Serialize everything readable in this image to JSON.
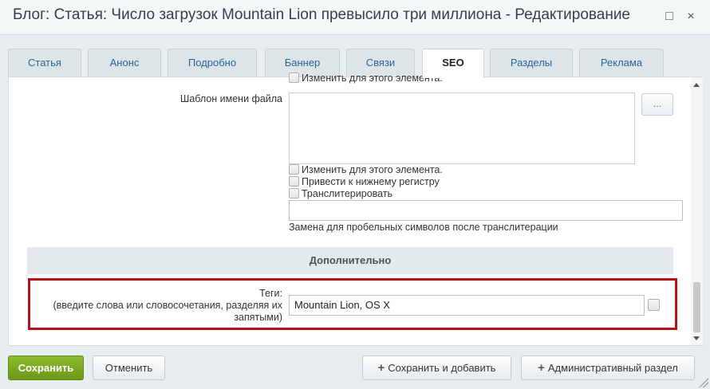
{
  "window": {
    "title": "Блог: Статья: Число загрузок Mountain Lion превысило три миллиона - Редактирование",
    "maximize_icon": "maximize-icon",
    "close_icon": "close-icon",
    "maximize_glyph": "□",
    "close_glyph": "×"
  },
  "tabs": [
    {
      "label": "Статья"
    },
    {
      "label": "Анонс"
    },
    {
      "label": "Подробно"
    },
    {
      "label": "Баннер"
    },
    {
      "label": "Связи"
    },
    {
      "label": "SEO",
      "active": true
    },
    {
      "label": "Разделы"
    },
    {
      "label": "Реклама"
    }
  ],
  "form": {
    "partial_checkbox_label": "Изменить для этого элемента.",
    "file_name_template_label": "Шаблон имени файла",
    "file_name_template_value": "",
    "dots_button": "...",
    "checkboxes": [
      {
        "label": "Изменить для этого элемента.",
        "checked": false
      },
      {
        "label": "Привести к нижнему регистру",
        "checked": false
      },
      {
        "label": "Транслитерировать",
        "checked": false
      }
    ],
    "space_replacement_value": "",
    "space_replacement_hint": "Замена для пробельных символов после транслитерации",
    "section_title": "Дополнительно",
    "tags_label_line1": "Теги:",
    "tags_label_line2": "(введите слова или словосочетания, разделяя их",
    "tags_label_line3": "запятыми)",
    "tags_value": "Mountain Lion, OS X"
  },
  "buttons": {
    "save": "Сохранить",
    "cancel": "Отменить",
    "save_and_add": "Сохранить и добавить",
    "admin_section": "Административный раздел",
    "plus_glyph": "+"
  },
  "colors": {
    "primary_button": "#7aaa22",
    "highlight_border": "#b5121b",
    "tab_text": "#2a6496"
  }
}
